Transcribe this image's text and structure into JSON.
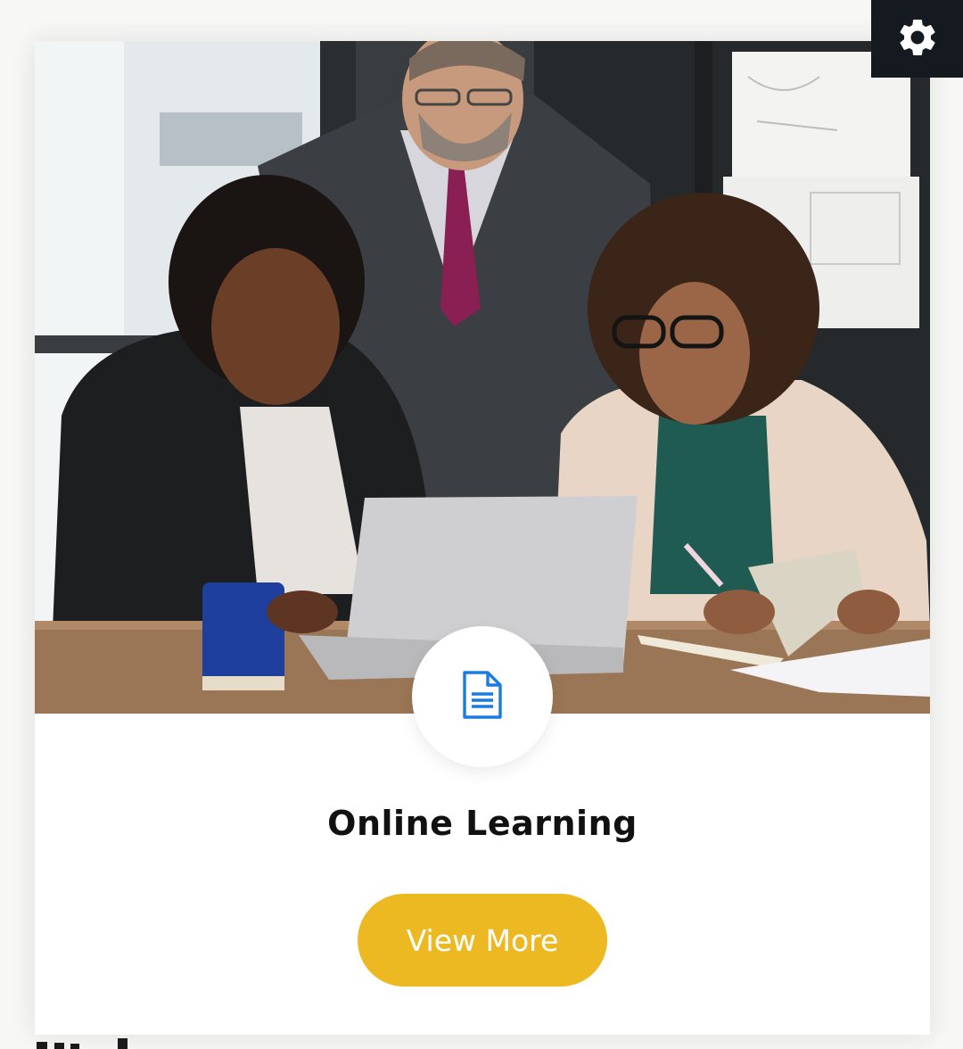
{
  "settings": {
    "icon": "gear-icon"
  },
  "card": {
    "image_alt": "Three colleagues looking at a laptop in an office",
    "icon": "document-icon",
    "title": "Online Learning",
    "button_label": "View More"
  },
  "colors": {
    "accent": "#edb923",
    "icon_blue": "#1a7be0",
    "settings_bg": "#141a20"
  }
}
